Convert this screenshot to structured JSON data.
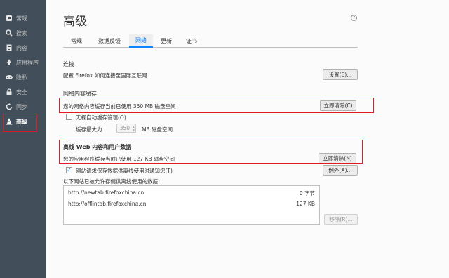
{
  "sidebar": {
    "items": [
      {
        "label": "常规",
        "icon": "home-icon"
      },
      {
        "label": "搜索",
        "icon": "search-icon"
      },
      {
        "label": "内容",
        "icon": "document-icon"
      },
      {
        "label": "应用程序",
        "icon": "rocket-icon"
      },
      {
        "label": "隐私",
        "icon": "mask-icon"
      },
      {
        "label": "安全",
        "icon": "lock-icon"
      },
      {
        "label": "同步",
        "icon": "sync-icon"
      },
      {
        "label": "高级",
        "icon": "wizard-hat-icon"
      }
    ],
    "active_index": 7
  },
  "header": {
    "title": "高级",
    "help": "?"
  },
  "tabs": [
    {
      "label": "常规"
    },
    {
      "label": "数据反馈"
    },
    {
      "label": "网络"
    },
    {
      "label": "更新"
    },
    {
      "label": "证书"
    }
  ],
  "active_tab": "网络",
  "connection": {
    "title": "连接",
    "desc": "配置 Firefox 如何连接至国际互联网",
    "button": "设置(E)..."
  },
  "web_cache": {
    "title": "网络内容缓存",
    "desc": "您的网络内容缓存当前已使用 350 MB 磁盘空间",
    "button": "立即清除(C)",
    "override_label": "无视自动缓存管理(O)",
    "override_checked": false,
    "limit_label": "缓存最大为",
    "limit_value": "350",
    "limit_unit": "MB 磁盘空间"
  },
  "offline": {
    "title": "离线 Web 内容和用户数据",
    "desc": "您的应用程序缓存当前已使用 127 KB 磁盘空间",
    "button": "立即清除(N)",
    "notify_label": "网站请求保存数据供离线使用时通知您(T)",
    "notify_checked": true,
    "exceptions_button": "例外(X)...",
    "list_caption": "以下网站已被允许存储供离线使用的数据：",
    "sites": [
      {
        "site": "http://newtab.firefoxchina.cn",
        "size": "0 字节"
      },
      {
        "site": "http://offlintab.firefoxchina.cn",
        "size": "127 KB"
      }
    ],
    "remove_button": "移除(R)..."
  },
  "colors": {
    "sidebar_bg": "#424f5a",
    "accent": "#0a84ff",
    "highlight_box": "#e01b24"
  }
}
